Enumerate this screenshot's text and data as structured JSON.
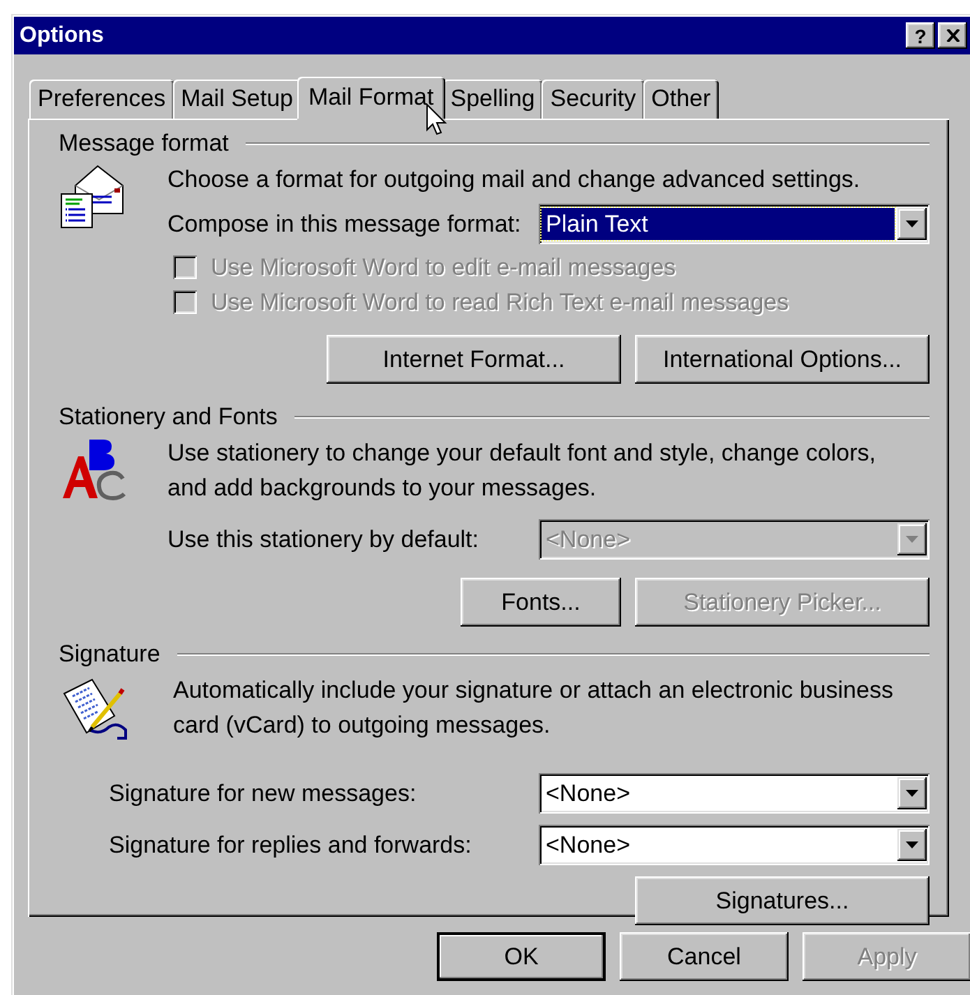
{
  "window": {
    "title": "Options",
    "help_button": "?"
  },
  "tabs": [
    {
      "label": "Preferences",
      "selected": false
    },
    {
      "label": "Mail Setup",
      "selected": false
    },
    {
      "label": "Mail Format",
      "selected": true
    },
    {
      "label": "Spelling",
      "selected": false
    },
    {
      "label": "Security",
      "selected": false
    },
    {
      "label": "Other",
      "selected": false
    }
  ],
  "message_format": {
    "heading": "Message format",
    "description": "Choose a format for outgoing mail and change advanced settings.",
    "compose_label": "Compose in this message format:",
    "compose_value": "Plain Text",
    "compose_focused": true,
    "options": [
      {
        "label": "Use Microsoft Word to edit e-mail messages",
        "checked": false,
        "disabled": true
      },
      {
        "label": "Use Microsoft Word to read Rich Text e-mail messages",
        "checked": false,
        "disabled": true
      }
    ],
    "buttons": [
      {
        "label": "Internet Format...",
        "disabled": false
      },
      {
        "label": "International Options...",
        "disabled": false
      }
    ]
  },
  "stationery": {
    "heading": "Stationery and Fonts",
    "description": "Use stationery to change your default font and style, change colors, and add backgrounds to your messages.",
    "default_label": "Use this stationery by default:",
    "default_value": "<None>",
    "default_disabled": true,
    "buttons": [
      {
        "label": "Fonts...",
        "disabled": false
      },
      {
        "label": "Stationery Picker...",
        "disabled": true
      }
    ]
  },
  "signature": {
    "heading": "Signature",
    "description": "Automatically include your signature or attach an electronic business card (vCard) to outgoing messages.",
    "fields": [
      {
        "label": "Signature for new messages:",
        "value": "<None>"
      },
      {
        "label": "Signature for replies and forwards:",
        "value": "<None>"
      }
    ],
    "buttons": [
      {
        "label": "Signatures...",
        "disabled": false
      }
    ]
  },
  "buttons": [
    {
      "label": "OK",
      "default": true,
      "disabled": false
    },
    {
      "label": "Cancel",
      "default": false,
      "disabled": false
    },
    {
      "label": "Apply",
      "default": false,
      "disabled": true
    }
  ]
}
